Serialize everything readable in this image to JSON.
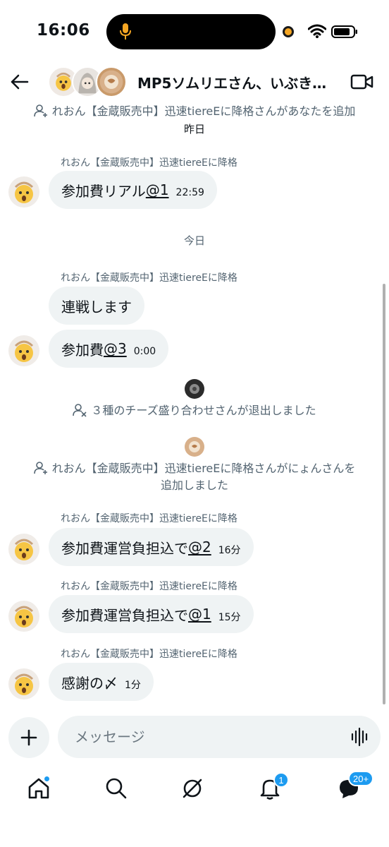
{
  "status_bar": {
    "time": "16:06"
  },
  "header": {
    "title": "MP5ソムリエさん、いぶき…",
    "back_icon": "back-arrow-icon",
    "video_icon": "video-call-icon"
  },
  "messages": {
    "sys_added_top": "れおん【金蔵販売中】迅速tiereEに降格さんがあなたを追加",
    "date_yesterday": "昨日",
    "sender_1": "れおん【金蔵販売中】迅速tiereEに降格",
    "bubble_1_text": "参加費リアル",
    "bubble_1_mention": "@1",
    "bubble_1_time": "22:59",
    "date_today": "今日",
    "sender_2": "れおん【金蔵販売中】迅速tiereEに降格",
    "bubble_2_text": "連戦します",
    "bubble_3_text": "参加費",
    "bubble_3_mention": "@3",
    "bubble_3_time": "0:00",
    "sys_left": "３種のチーズ盛り合わせさんが退出しました",
    "sys_added_line1": "れおん【金蔵販売中】迅速tiereEに降格さんがにょんさんを",
    "sys_added_line2": "追加しました",
    "sender_4": "れおん【金蔵販売中】迅速tiereEに降格",
    "bubble_4_text": "参加費運営負担込で",
    "bubble_4_mention": "@2",
    "bubble_4_time": "16分",
    "sender_5": "れおん【金蔵販売中】迅速tiereEに降格",
    "bubble_5_text": "参加費運営負担込で",
    "bubble_5_mention": "@1",
    "bubble_5_time": "15分",
    "sender_6": "れおん【金蔵販売中】迅速tiereEに降格",
    "bubble_6_text": "感謝の〆",
    "bubble_6_time": "1分"
  },
  "composer": {
    "placeholder": "メッセージ"
  },
  "nav": {
    "notifications_badge": "1",
    "messages_badge": "20+"
  },
  "colors": {
    "accent": "#1d9bf0",
    "bubble_bg": "#eff3f4",
    "muted_text": "#536471"
  }
}
